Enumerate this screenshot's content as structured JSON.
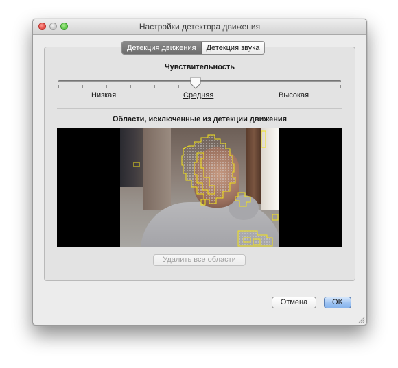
{
  "window": {
    "title": "Настройки детектора движения"
  },
  "tabs": [
    {
      "label": "Детекция движения",
      "active": true
    },
    {
      "label": "Детекция звука",
      "active": false
    }
  ],
  "sensitivity": {
    "title": "Чувствительность",
    "levels": [
      "Низкая",
      "Средняя",
      "Высокая"
    ],
    "selected": "Средняя"
  },
  "exclusion": {
    "title": "Области, исключенные из детекции движения",
    "delete_all_label": "Удалить все области"
  },
  "buttons": {
    "cancel_label": "Отмена",
    "ok_label": "OK"
  },
  "colors": {
    "overlay": "#f2e21a",
    "accent": "#86b3ec"
  },
  "icons": {
    "close": "close-icon",
    "minimize": "minimize-icon",
    "zoom": "zoom-icon",
    "resize": "resize-grip-icon"
  }
}
